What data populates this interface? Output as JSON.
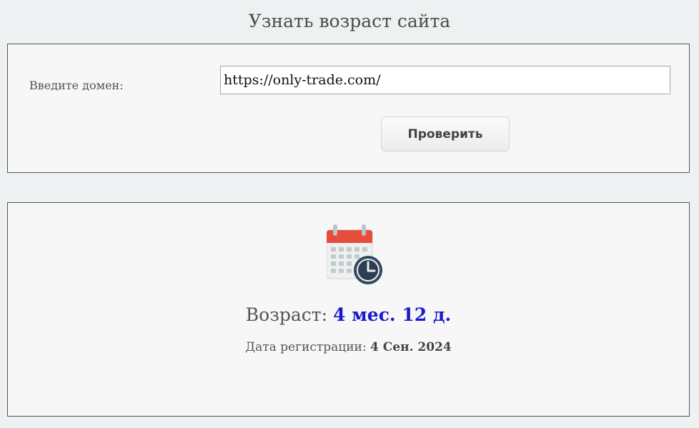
{
  "page": {
    "title": "Узнать возраст сайта"
  },
  "form": {
    "domain_label": "Введите домен:",
    "domain_value": "https://only-trade.com/",
    "check_button_label": "Проверить"
  },
  "result": {
    "icon": "calendar-clock-icon",
    "age_label": "Возраст:",
    "age_value": "4 мес. 12 д.",
    "registration_label": "Дата регистрации:",
    "registration_value": "4 Сен. 2024"
  },
  "colors": {
    "age_value": "#1a1acc",
    "calendar_header": "#e74c3c",
    "clock_face": "#34495e"
  }
}
